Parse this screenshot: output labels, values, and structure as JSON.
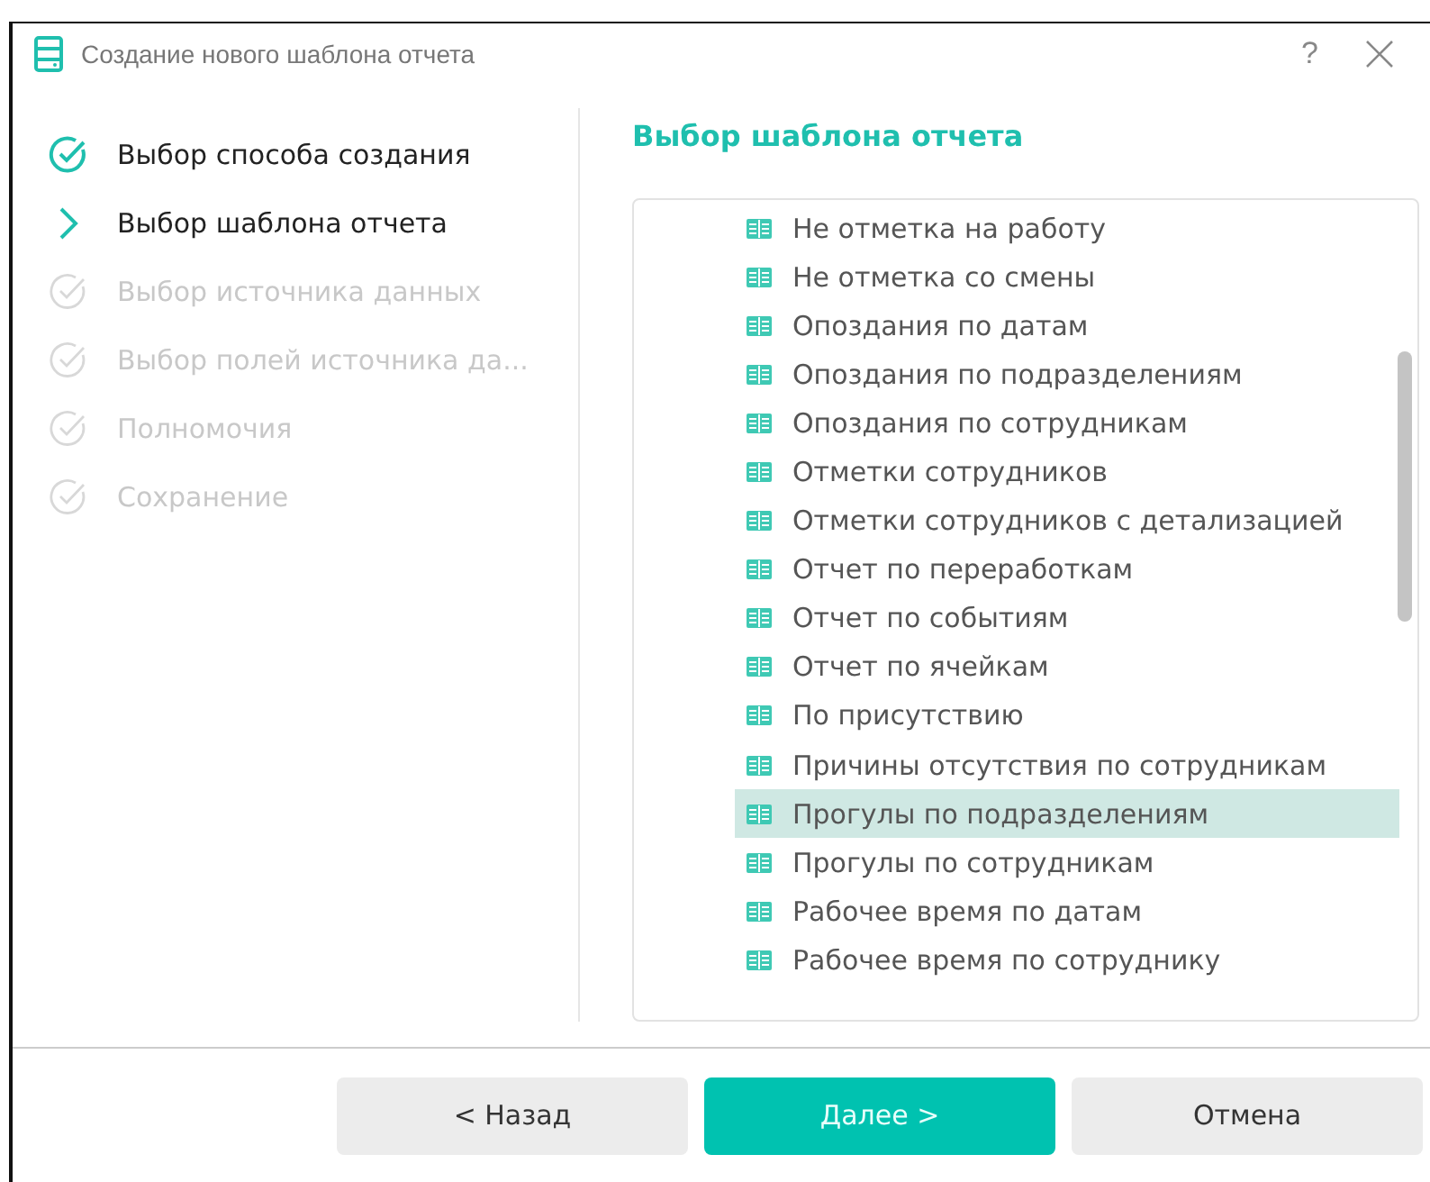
{
  "window": {
    "title": "Создание нового шаблона отчета",
    "help": "?"
  },
  "steps": [
    {
      "label": "Выбор способа создания",
      "kind": "done"
    },
    {
      "label": "Выбор шаблона отчета",
      "kind": "current"
    },
    {
      "label": "Выбор источника данных",
      "kind": "pending"
    },
    {
      "label": "Выбор полей источника да...",
      "kind": "pending"
    },
    {
      "label": "Полномочия",
      "kind": "pending"
    },
    {
      "label": "Сохранение",
      "kind": "pending"
    }
  ],
  "heading": "Выбор шаблона отчета",
  "templates": [
    {
      "label": "Не отметка на работу",
      "selected": false
    },
    {
      "label": "Не отметка со смены",
      "selected": false
    },
    {
      "label": "Опоздания по датам",
      "selected": false
    },
    {
      "label": "Опоздания по подразделениям",
      "selected": false
    },
    {
      "label": "Опоздания по сотрудникам",
      "selected": false
    },
    {
      "label": "Отметки сотрудников",
      "selected": false
    },
    {
      "label": "Отметки сотрудников с детализацией",
      "selected": false
    },
    {
      "label": "Отчет по переработкам",
      "selected": false
    },
    {
      "label": "Отчет по событиям",
      "selected": false
    },
    {
      "label": "Отчет по ячейкам",
      "selected": false
    },
    {
      "label": "По присутствию",
      "selected": false
    },
    {
      "label": "Причины отсутствия по сотрудникам",
      "selected": false
    },
    {
      "label": "Прогулы по подразделениям",
      "selected": true
    },
    {
      "label": "Прогулы по сотрудникам",
      "selected": false
    },
    {
      "label": "Рабочее время по датам",
      "selected": false
    },
    {
      "label": "Рабочее время по сотруднику",
      "selected": false
    }
  ],
  "buttons": [
    {
      "label": "< Назад",
      "kind": "secondary"
    },
    {
      "label": "Далее >",
      "kind": "primary"
    },
    {
      "label": "Отмена",
      "kind": "secondary"
    }
  ]
}
